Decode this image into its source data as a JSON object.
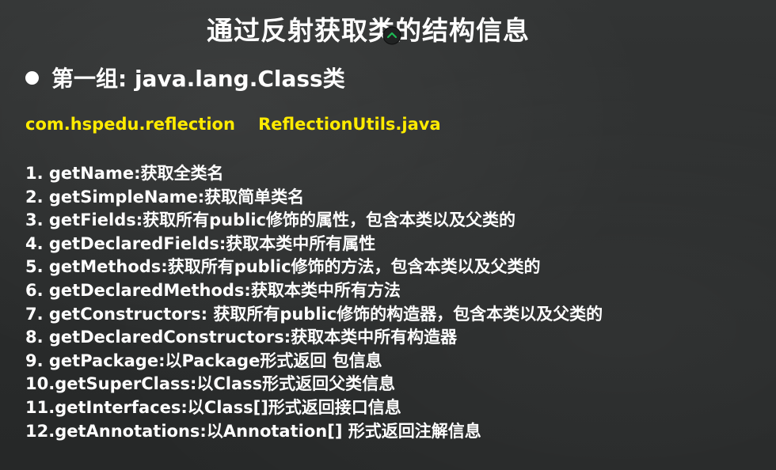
{
  "title": "通过反射获取类的结构信息",
  "bullet": {
    "text": "第一组: java.lang.Class类"
  },
  "package_line": "com.hspedu.reflection    ReflectionUtils.java",
  "methods": [
    "1.  getName:获取全类名",
    "2.  getSimpleName:获取简单类名",
    "3.  getFields:获取所有public修饰的属性，包含本类以及父类的",
    "4.  getDeclaredFields:获取本类中所有属性",
    "5.  getMethods:获取所有public修饰的方法，包含本类以及父类的",
    "6.  getDeclaredMethods:获取本类中所有方法",
    "7.  getConstructors: 获取所有public修饰的构造器，包含本类以及父类的",
    "8.  getDeclaredConstructors:获取本类中所有构造器",
    "9.  getPackage:以Package形式返回 包信息",
    "10.getSuperClass:以Class形式返回父类信息",
    "11.getInterfaces:以Class[]形式返回接口信息",
    "12.getAnnotations:以Annotation[] 形式返回注解信息"
  ],
  "colors": {
    "background": "#2b2d2d",
    "text": "#ffffff",
    "package_highlight": "#ffeb00",
    "cursor_accent": "#1db954"
  },
  "icons": {
    "cursor": "pointer-cursor-icon"
  }
}
